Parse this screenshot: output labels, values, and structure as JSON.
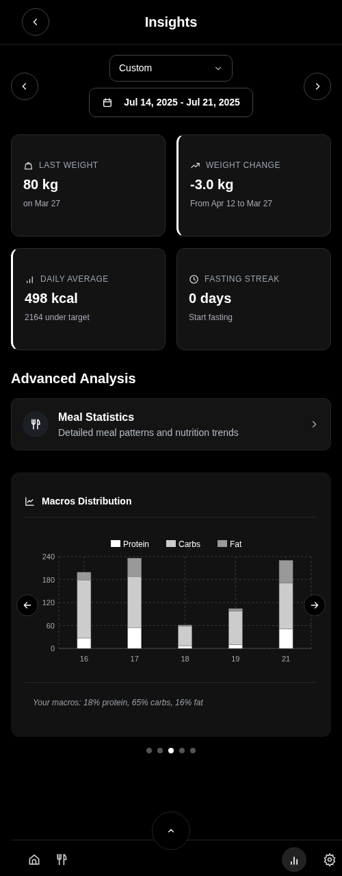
{
  "header": {
    "title": "Insights"
  },
  "range": {
    "period": "Custom",
    "dates": "Jul 14, 2025 - Jul 21, 2025"
  },
  "stats": [
    {
      "label": "LAST WEIGHT",
      "value": "80 kg",
      "sub": "on Mar 27",
      "highlighted": false
    },
    {
      "label": "WEIGHT CHANGE",
      "value": "-3.0 kg",
      "sub": "From Apr 12 to Mar 27",
      "highlighted": true
    },
    {
      "label": "DAILY AVERAGE",
      "value": "498 kcal",
      "sub": "2164 under target",
      "highlighted": true
    },
    {
      "label": "FASTING STREAK",
      "value": "0 days",
      "sub": "Start fasting",
      "highlighted": false
    }
  ],
  "advanced": {
    "heading": "Advanced Analysis",
    "item": {
      "title": "Meal Statistics",
      "subtitle": "Detailed meal patterns and nutrition trends"
    }
  },
  "macros": {
    "title": "Macros Distribution",
    "summary": "Your macros: 18% protein, 65% carbs, 16% fat",
    "chart_data": {
      "type": "bar",
      "stacked": true,
      "grid": true,
      "legend": true,
      "categories": [
        "16",
        "17",
        "18",
        "19",
        "21"
      ],
      "ylim": [
        0,
        240
      ],
      "yticks": [
        0,
        60,
        120,
        180,
        240
      ],
      "series": [
        {
          "name": "Protein",
          "color": "#ffffff",
          "values": [
            27,
            54,
            7,
            10,
            51
          ]
        },
        {
          "name": "Carbs",
          "color": "#cccccc",
          "values": [
            152,
            134,
            51,
            88,
            120
          ]
        },
        {
          "name": "Fat",
          "color": "#999999",
          "values": [
            20,
            48,
            3,
            6,
            59
          ]
        }
      ]
    }
  },
  "pager": [
    {
      "selected": false
    },
    {
      "selected": false
    },
    {
      "selected": true
    },
    {
      "selected": false
    },
    {
      "selected": false
    }
  ],
  "nav": [
    {
      "selected": false
    },
    {
      "selected": false
    },
    {
      "selected": true
    },
    {
      "selected": false
    }
  ]
}
